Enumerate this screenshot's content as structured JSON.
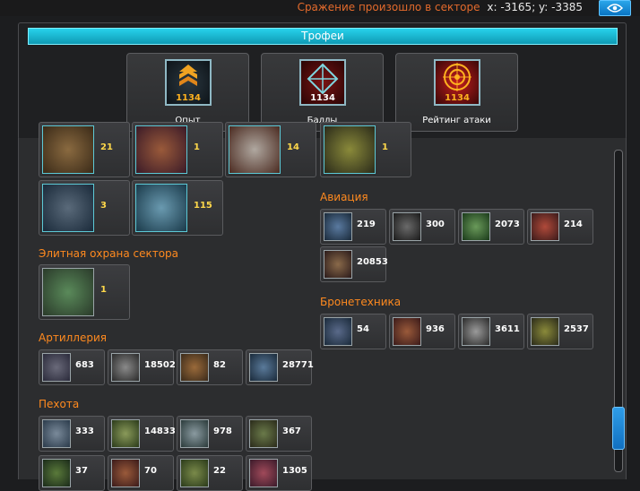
{
  "topbar": {
    "message": "Сражение произошло в секторе",
    "coords": "x: -3165; y: -3385",
    "eye_icon": "eye-icon"
  },
  "trophies": {
    "title": "Трофеи",
    "cards": [
      {
        "label": "Опыт",
        "value": "1134",
        "icon": "rank-chevron-icon"
      },
      {
        "label": "Баллы",
        "value": "1134",
        "icon": "diamond-icon"
      },
      {
        "label": "Рейтинг атаки",
        "value": "1134",
        "icon": "target-icon"
      }
    ]
  },
  "left_top_units": [
    "21",
    "1",
    "14",
    "3",
    "115"
  ],
  "right_top_units": [
    "1"
  ],
  "sections": {
    "elite": {
      "title": "Элитная охрана сектора",
      "units": [
        "1"
      ]
    },
    "artillery": {
      "title": "Артиллерия",
      "units": [
        "683",
        "18502",
        "82",
        "28771"
      ]
    },
    "infantry": {
      "title": "Пехота",
      "units": [
        "333",
        "14833",
        "978",
        "367",
        "37",
        "70",
        "22",
        "1305"
      ]
    },
    "aviation": {
      "title": "Авиация",
      "units": [
        "219",
        "300",
        "2073",
        "214",
        "20853"
      ]
    },
    "armor": {
      "title": "Бронетехника",
      "units": [
        "54",
        "936",
        "3611",
        "2537"
      ]
    }
  },
  "colors": {
    "accent_orange": "#ff8a1f",
    "count_yellow": "#ffd84a",
    "header_cyan": "#1fc0dc",
    "button_blue": "#1a8ad8"
  }
}
